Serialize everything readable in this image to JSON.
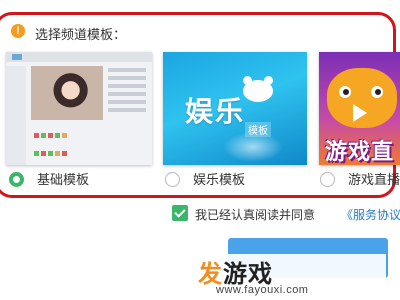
{
  "section": {
    "title": "选择频道模板："
  },
  "templates": [
    {
      "label": "基础模板",
      "selected": true
    },
    {
      "label": "娱乐模板",
      "selected": false
    },
    {
      "label": "游戏直播",
      "selected": false
    }
  ],
  "thumb_entertainment": {
    "main_text": "娱乐",
    "badge_text": "模板"
  },
  "thumb_game": {
    "main_text": "游戏直"
  },
  "agreement": {
    "checked": true,
    "text": "我已经认真阅读并同意",
    "link_text": "《服务协议"
  },
  "watermark": {
    "brand_a": "发",
    "brand_b": "游戏",
    "url": "www.fayouxi.com"
  },
  "colors": {
    "accent_green": "#3bb56a",
    "highlight_red": "#d2141c",
    "button_blue": "#4aa3e8",
    "link_blue": "#2b7bc4"
  }
}
